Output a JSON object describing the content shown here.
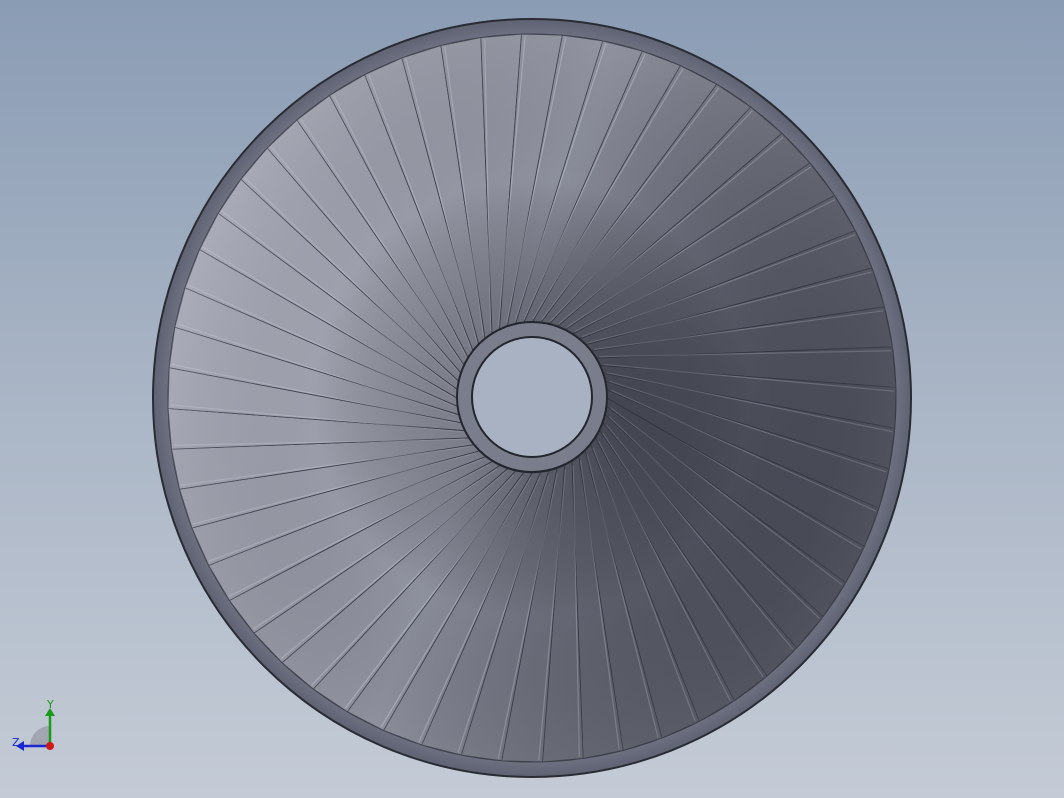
{
  "model": {
    "blade_count": 56,
    "colors": {
      "background_top": "#8a9cb4",
      "background_bottom": "#c4cbd6",
      "rim": "#6e7282",
      "rim_edge": "#2a2c34",
      "blade_light": "#b3b8c8",
      "blade_dark": "#4e5264",
      "hub": "#7a7e8c"
    }
  },
  "triad": {
    "y_label": "Y",
    "z_label": "Z",
    "x_color": "#d01818",
    "y_color": "#1a9a1a",
    "z_color": "#1a2ad0"
  }
}
